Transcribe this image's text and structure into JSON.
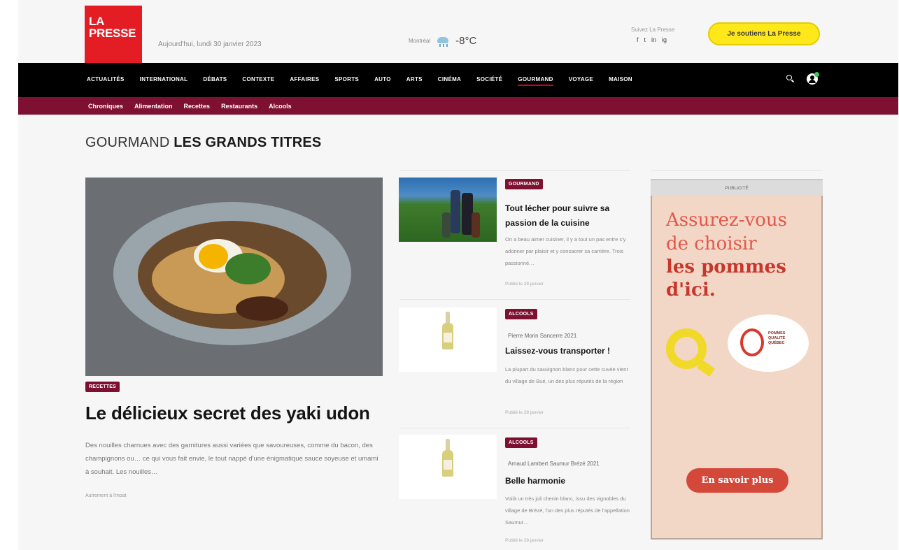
{
  "header": {
    "logo_line1": "LA",
    "logo_line2": "PRESSE",
    "date": "Aujourd'hui, lundi 30 janvier 2023",
    "weather_city": "Montréal",
    "weather_temp": "-8°C",
    "follow_label": "Suivez La Presse",
    "social": [
      "f",
      "t",
      "in",
      "ig"
    ],
    "support_label": "Je soutiens La Presse"
  },
  "nav": {
    "items": [
      "ACTUALITÉS",
      "INTERNATIONAL",
      "DÉBATS",
      "CONTEXTE",
      "AFFAIRES",
      "SPORTS",
      "AUTO",
      "ARTS",
      "CINÉMA",
      "SOCIÉTÉ",
      "GOURMAND",
      "VOYAGE",
      "MAISON"
    ],
    "active": "GOURMAND"
  },
  "subnav": {
    "items": [
      "Chroniques",
      "Alimentation",
      "Recettes",
      "Restaurants",
      "Alcools"
    ]
  },
  "section": {
    "prefix": "GOURMAND",
    "title": "LES GRANDS TITRES"
  },
  "main_article": {
    "tag": "RECETTES",
    "headline": "Le délicieux secret des yaki udon",
    "summary": "Des nouilles charnues avec des garnitures aussi variées que savoureuses, comme du bacon, des champignons ou… ce qui vous fait envie, le tout nappé d'une énigmatique sauce soyeuse et umami à souhait. Les nouilles…",
    "author": "Autrement à l'moat"
  },
  "side_articles": [
    {
      "tag": "GOURMAND",
      "wine": "",
      "title": "Tout lécher pour suivre sa passion de la cuisine",
      "excerpt": "On a beau aimer cuisiner, il y a tout un pas entre s'y adonner par plaisir et y consacrer sa carrière. Trois passionné…",
      "date": "Publié le 28 janvier"
    },
    {
      "tag": "ALCOOLS",
      "wine": "Pierre Morin Sancerre 2021",
      "title": "Laissez-vous transporter !",
      "excerpt": "La plupart du sauvignon blanc pour cette cuvée vient du village de Bué, un des plus réputés de la région",
      "date": "Publié le 28 janvier"
    },
    {
      "tag": "ALCOOLS",
      "wine": "Arnaud Lambert Saumur Brézé 2021",
      "title": "Belle harmonie",
      "excerpt": "Voilà un très joli chenin blanc, issu des vignobles du village de Brézé, l'un des plus réputés de l'appellation Saumur…",
      "date": "Publié le 28 janvier"
    }
  ],
  "ad": {
    "label": "PUBLICITÉ",
    "line1": "Assurez-vous de choisir",
    "line2": "les pommes d'ici.",
    "badge_text": "POMMES QUALITÉ QUÉBEC",
    "cta": "En savoir plus"
  }
}
